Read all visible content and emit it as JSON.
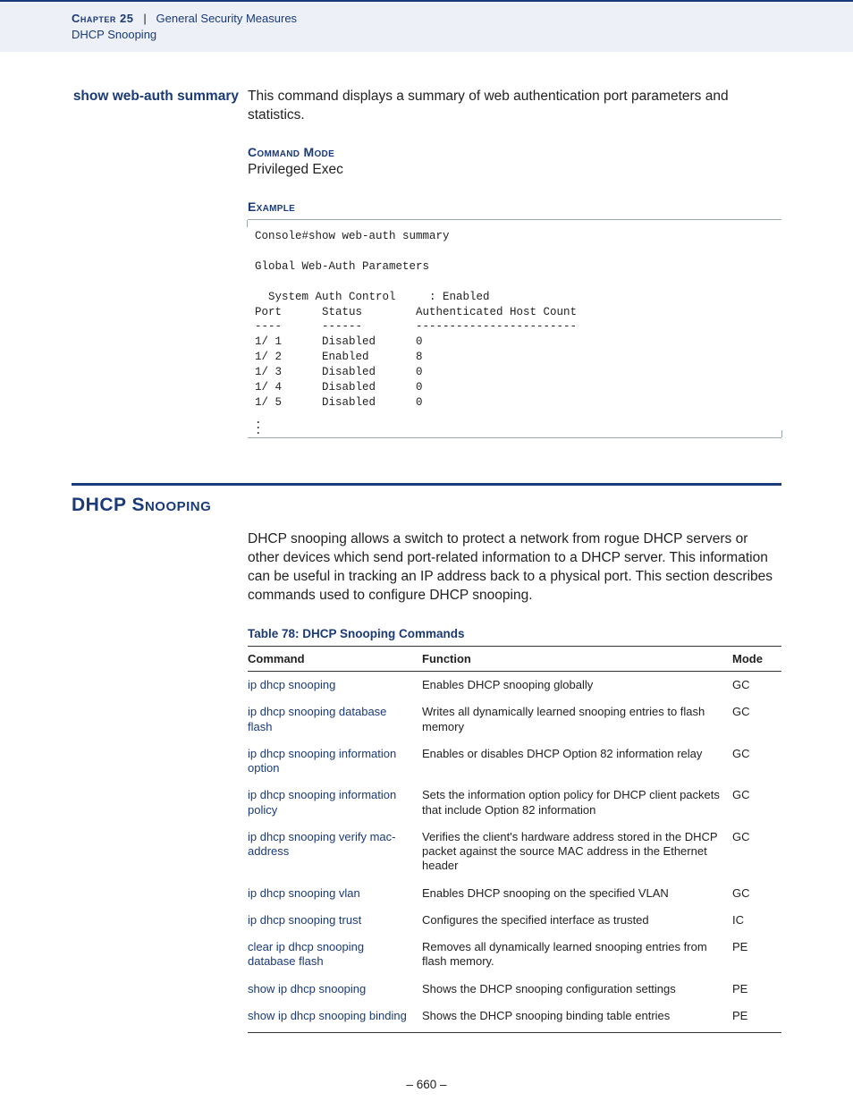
{
  "header": {
    "chapter_label": "Chapter 25",
    "separator": "|",
    "chapter_title": "General Security Measures",
    "subtitle": "DHCP Snooping"
  },
  "command": {
    "name": "show web-auth summary",
    "description": "This command displays a summary of web authentication port parameters and statistics.",
    "mode_label": "Command Mode",
    "mode_value": "Privileged Exec",
    "example_label": "Example",
    "example_text": "Console#show web-auth summary\n\nGlobal Web-Auth Parameters\n\n  System Auth Control     : Enabled\nPort      Status        Authenticated Host Count\n----      ------        ------------------------\n1/ 1      Disabled      0\n1/ 2      Enabled       8\n1/ 3      Disabled      0\n1/ 4      Disabled      0\n1/ 5      Disabled      0"
  },
  "section": {
    "heading": "DHCP Snooping",
    "intro": "DHCP snooping allows a switch to protect a network from rogue DHCP servers or other devices which send port-related information to a DHCP server. This information can be useful in tracking an IP address back to a physical port. This section describes commands used to configure DHCP snooping.",
    "table_caption": "Table 78: DHCP Snooping Commands",
    "table_headers": {
      "c1": "Command",
      "c2": "Function",
      "c3": "Mode"
    },
    "rows": [
      {
        "cmd": "ip dhcp snooping",
        "func": "Enables DHCP snooping globally",
        "mode": "GC"
      },
      {
        "cmd": "ip dhcp snooping database flash",
        "func": "Writes all dynamically learned snooping entries to flash memory",
        "mode": "GC"
      },
      {
        "cmd": "ip dhcp snooping information option",
        "func": "Enables or disables DHCP Option 82 information relay",
        "mode": "GC"
      },
      {
        "cmd": "ip dhcp snooping information policy",
        "func": "Sets the information option policy for DHCP client packets that include Option 82 information",
        "mode": "GC"
      },
      {
        "cmd": "ip dhcp snooping verify mac-address",
        "func": "Verifies the client's hardware address stored in the DHCP packet against the source MAC address in the Ethernet header",
        "mode": "GC"
      },
      {
        "cmd": "ip dhcp snooping vlan",
        "func": "Enables DHCP snooping on the specified VLAN",
        "mode": "GC"
      },
      {
        "cmd": "ip dhcp snooping trust",
        "func": "Configures the specified interface as trusted",
        "mode": "IC"
      },
      {
        "cmd": "clear ip dhcp snooping database flash",
        "func": "Removes all dynamically learned snooping entries from flash memory.",
        "mode": "PE"
      },
      {
        "cmd": "show ip dhcp snooping",
        "func": "Shows the DHCP snooping configuration settings",
        "mode": "PE"
      },
      {
        "cmd": "show ip dhcp snooping binding",
        "func": "Shows the DHCP snooping binding table entries",
        "mode": "PE"
      }
    ]
  },
  "page_number": "– 660 –",
  "chart_data": {
    "type": "table",
    "title": "Global Web-Auth Parameters",
    "system_auth_control": "Enabled",
    "columns": [
      "Port",
      "Status",
      "Authenticated Host Count"
    ],
    "rows": [
      [
        "1/ 1",
        "Disabled",
        0
      ],
      [
        "1/ 2",
        "Enabled",
        8
      ],
      [
        "1/ 3",
        "Disabled",
        0
      ],
      [
        "1/ 4",
        "Disabled",
        0
      ],
      [
        "1/ 5",
        "Disabled",
        0
      ]
    ]
  }
}
